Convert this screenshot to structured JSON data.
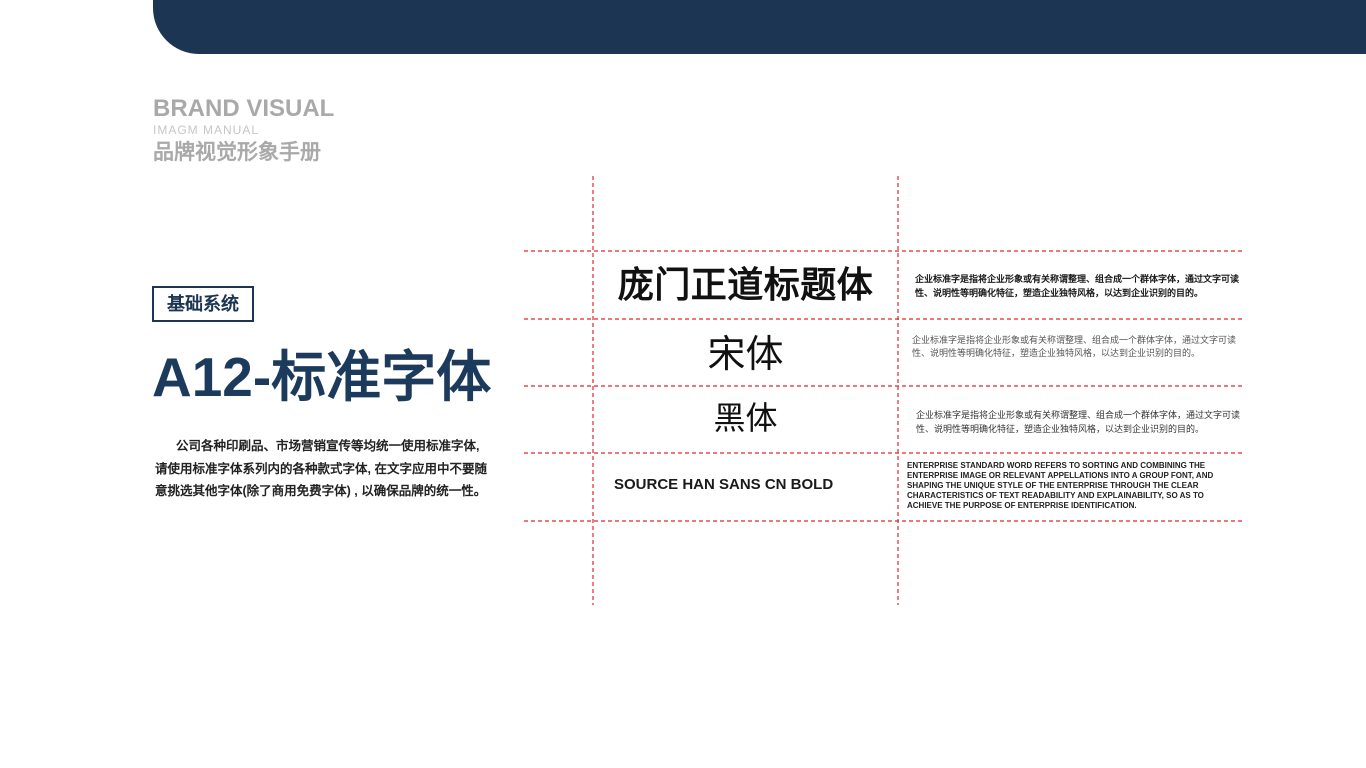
{
  "header": {
    "brand_title": "BRAND VISUAL",
    "brand_subtitle": "IMAGM MANUAL",
    "brand_cn": "品牌视觉形象手册"
  },
  "section": {
    "tag": "基础系统",
    "title": "A12-标准字体",
    "description": [
      "公司各种印刷品、市场营销宣传等均统一使用标准字体,",
      "请使用标准字体系列内的各种款式字体, 在文字应用中不要随",
      "意挑选其他字体(除了商用免费字体) , 以确保品牌的统一性。"
    ]
  },
  "font_specimens": [
    {
      "name": "庞门正道标题体",
      "description": [
        "企业标准字是指将企业形象或有关称谓整理、组合成一个群体字体，通过文字可读",
        "性、说明性等明确化特征，塑造企业独特风格，以达到企业识别的目的。"
      ]
    },
    {
      "name": "宋体",
      "description": [
        "企业标准字是指将企业形象或有关称谓整理、组合成一个群体字体，通过文字可读",
        "性、说明性等明确化特征，塑造企业独特风格，以达到企业识别的目的。"
      ]
    },
    {
      "name": "黑体",
      "description": [
        "企业标准字是指将企业形象或有关称谓整理、组合成一个群体字体，通过文字可读",
        "性、说明性等明确化特征，塑造企业独特风格，以达到企业识别的目的。"
      ]
    },
    {
      "name": "SOURCE HAN SANS CN BOLD",
      "description": [
        "ENTERPRISE STANDARD WORD REFERS TO SORTING AND COMBINING THE",
        "ENTERPRISE IMAGE OR RELEVANT APPELLATIONS INTO A GROUP FONT, AND",
        "SHAPING THE UNIQUE STYLE OF THE ENTERPRISE THROUGH THE CLEAR",
        "CHARACTERISTICS OF TEXT READABILITY AND EXPLAINABILITY, SO AS TO",
        "ACHIEVE THE PURPOSE OF ENTERPRISE IDENTIFICATION."
      ]
    }
  ],
  "colors": {
    "primary_navy": "#1c3553",
    "brand_gray": "#a9a9a9",
    "grid_red": "#e0282e"
  }
}
